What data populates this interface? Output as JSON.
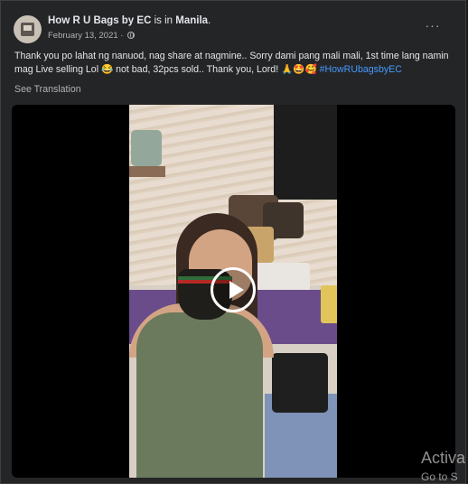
{
  "post": {
    "author": "How R U Bags by EC",
    "is_in": "is in",
    "location": "Manila",
    "location_suffix": ".",
    "date": "February 13, 2021",
    "date_sep": " · ",
    "privacy_icon": "globe-icon",
    "more_label": "···",
    "text_main": "Thank you po lahat ng nanuod, nag share at nagmine.. Sorry dami pang mali mali, 1st time lang namin mag Live selling Lol 😂  not bad, 32pcs sold.. Thank you, Lord! 🙏🤩🥰 ",
    "hashtag": "#HowRUbagsbyEC",
    "see_translation": "See Translation"
  },
  "video": {
    "play_icon": "play-icon"
  },
  "watermark": {
    "line1": "Activa",
    "line2": "Go to S"
  }
}
